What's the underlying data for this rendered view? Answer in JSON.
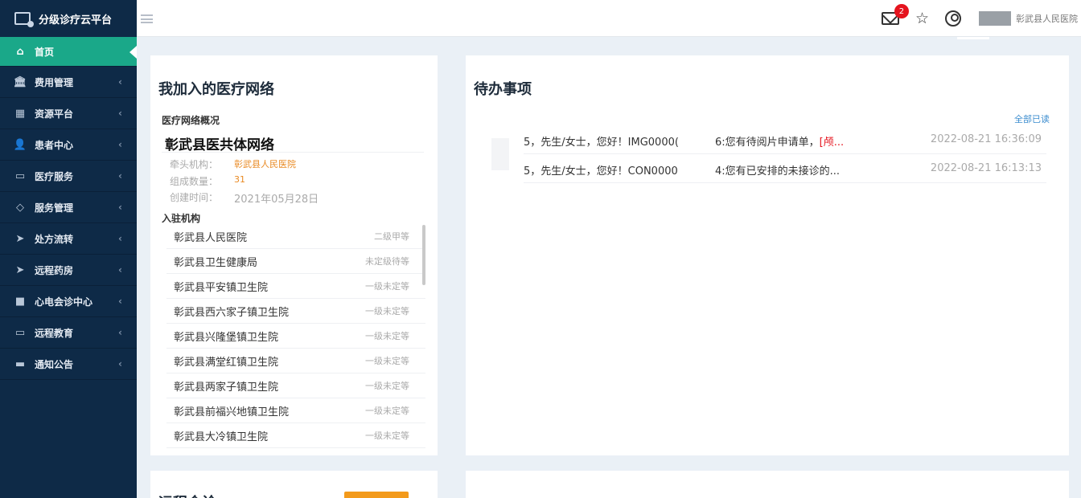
{
  "app": {
    "title": "分级诊疗云平台"
  },
  "sidebar": {
    "items": [
      {
        "label": "首页",
        "icon": "home-icon",
        "glyph": "⌂",
        "active": true
      },
      {
        "label": "费用管理",
        "icon": "bank-icon",
        "glyph": "🏛"
      },
      {
        "label": "资源平台",
        "icon": "grid-icon",
        "glyph": "▦"
      },
      {
        "label": "患者中心",
        "icon": "user-icon",
        "glyph": "👤"
      },
      {
        "label": "医疗服务",
        "icon": "calendar-icon",
        "glyph": "▭"
      },
      {
        "label": "服务管理",
        "icon": "diamond-icon",
        "glyph": "◇"
      },
      {
        "label": "处方流转",
        "icon": "send-icon",
        "glyph": "➤"
      },
      {
        "label": "远程药房",
        "icon": "send-icon",
        "glyph": "➤"
      },
      {
        "label": "心电会诊中心",
        "icon": "video-icon",
        "glyph": "■"
      },
      {
        "label": "远程教育",
        "icon": "monitor-icon",
        "glyph": "▭"
      },
      {
        "label": "通知公告",
        "icon": "car-icon",
        "glyph": "▬"
      }
    ]
  },
  "header": {
    "mail_badge": "2",
    "hospital": "彰武县人民医院"
  },
  "network_panel": {
    "title": "我加入的医疗网络",
    "overview_label": "医疗网络概况",
    "network_name": "彰武县医共体网络",
    "lead_label": "牵头机构：",
    "lead_value": "彰武县人民医院",
    "count_label": "组成数量：",
    "count_value": "31",
    "created_label": "创建时间：",
    "created_value": "2021年05月28日",
    "members_label": "入驻机构",
    "members": [
      {
        "name": "彰武县人民医院",
        "level": "二级甲等"
      },
      {
        "name": "彰武县卫生健康局",
        "level": "未定级待等"
      },
      {
        "name": "彰武县平安镇卫生院",
        "level": "一级未定等"
      },
      {
        "name": "彰武县西六家子镇卫生院",
        "level": "一级未定等"
      },
      {
        "name": "彰武县兴隆堡镇卫生院",
        "level": "一级未定等"
      },
      {
        "name": "彰武县满堂红镇卫生院",
        "level": "一级未定等"
      },
      {
        "name": "彰武县两家子镇卫生院",
        "level": "一级未定等"
      },
      {
        "name": "彰武县前福兴地镇卫生院",
        "level": "一级未定等"
      },
      {
        "name": "彰武县大冷镇卫生院",
        "level": "一级未定等"
      }
    ]
  },
  "todo_panel": {
    "title": "待办事项",
    "mark_all_read": "全部已读",
    "items": [
      {
        "greeting": "5，先生/女士，您好！IMG0000(",
        "message": "6:您有待阅片申请单，",
        "highlight": "[颅...",
        "time": "2022-08-21 16:36:09"
      },
      {
        "greeting": "5，先生/女士，您好！CON0000",
        "message": "4:您有已安排的未接诊的...",
        "highlight": "",
        "time": "2022-08-21 16:13:13"
      }
    ]
  },
  "bottom_left": {
    "title": "远程会诊"
  },
  "colors": {
    "sidebar_bg": "#0e2a47",
    "active": "#1aa889",
    "accent_orange": "#e98a23",
    "badge_red": "#e5141e",
    "link_blue": "#3c8dcf"
  }
}
